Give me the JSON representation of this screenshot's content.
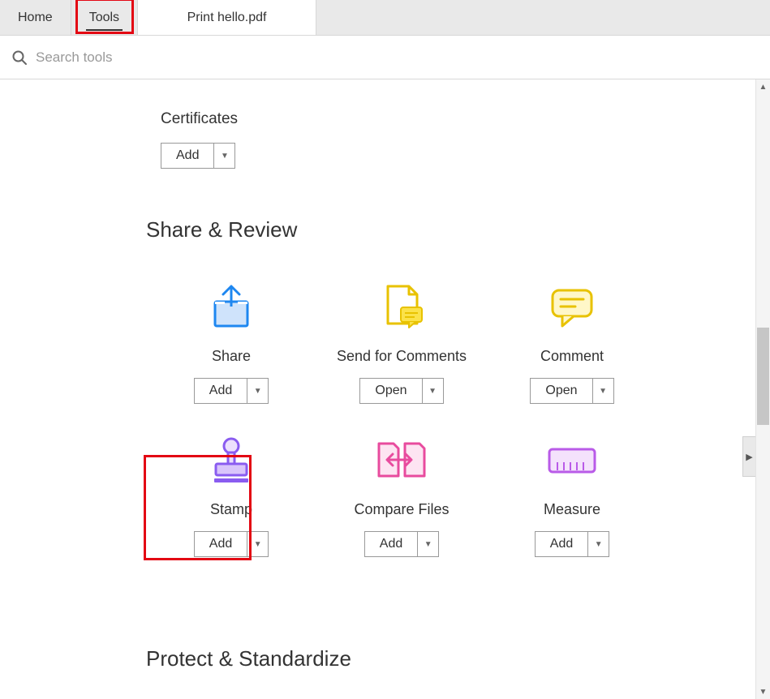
{
  "tabs": {
    "home": "Home",
    "tools": "Tools",
    "document": "Print hello.pdf"
  },
  "search": {
    "placeholder": "Search tools"
  },
  "certificates": {
    "label": "Certificates",
    "action": "Add"
  },
  "sections": {
    "share_review": {
      "title": "Share & Review",
      "tools": [
        {
          "name": "Share",
          "action": "Add"
        },
        {
          "name": "Send for Comments",
          "action": "Open"
        },
        {
          "name": "Comment",
          "action": "Open"
        },
        {
          "name": "Stamp",
          "action": "Add"
        },
        {
          "name": "Compare Files",
          "action": "Add"
        },
        {
          "name": "Measure",
          "action": "Add"
        }
      ]
    },
    "protect": {
      "title": "Protect & Standardize"
    }
  },
  "colors": {
    "blue": "#1e87f0",
    "blue_fill": "#cfe3fb",
    "yellow": "#e8c200",
    "yellow_fill": "#fbe24a",
    "purple": "#8a5cf0",
    "purple_fill": "#d9c5fb",
    "pink": "#e84b9e",
    "pink_fill": "#fbb7de",
    "red_highlight": "#e30613"
  }
}
